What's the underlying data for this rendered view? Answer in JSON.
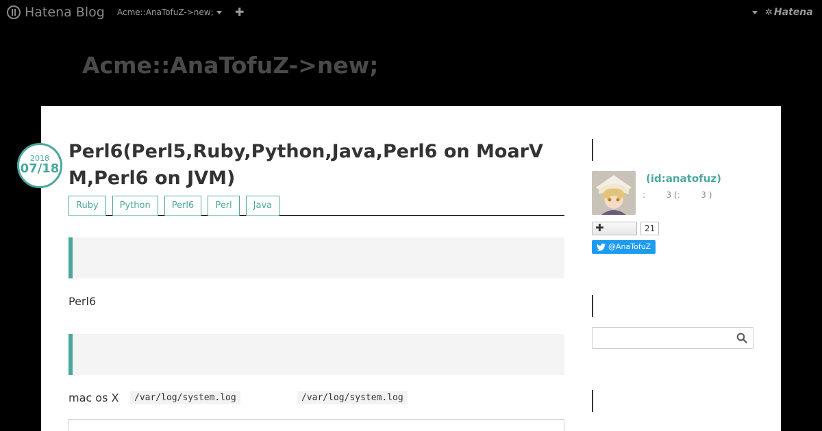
{
  "navbar": {
    "logo_text": "Hatena Blog",
    "blog_menu_label": "Acme::AnaTofuZ->new;",
    "add_symbol": "✚",
    "hatena_label": "Hatena"
  },
  "blog": {
    "title": "Acme::AnaTofuZ->new;"
  },
  "entry": {
    "date_year": "2018",
    "date_md": "07/18",
    "title": "Perl6(Perl5,Ruby,Python,Java,Perl6 on MoarVM,Perl6 on JVM)",
    "categories": [
      "Ruby",
      "Python",
      "Perl6",
      "Perl",
      "Java"
    ],
    "para1": "Perl6",
    "para2_prefix": "mac os X",
    "code1": "/var/log/system.log",
    "code2": "/var/log/system.log"
  },
  "sidebar": {
    "profile_id": "(id:anatofuz)",
    "profile_meta": ":        3 (:        3 )",
    "follow_count": "21",
    "twitter_label": "@AnaTofuZ",
    "search_placeholder": ""
  },
  "colors": {
    "accent": "#4aa79b",
    "twitter": "#1d9bf0"
  }
}
